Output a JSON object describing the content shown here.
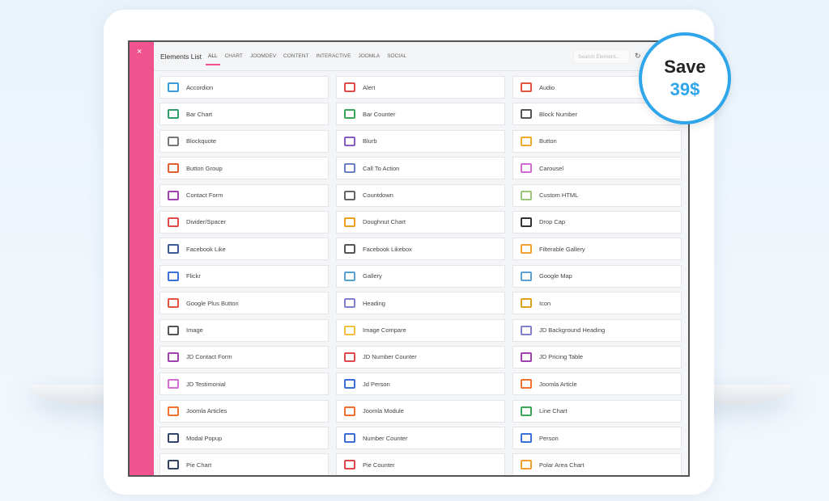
{
  "header": {
    "close": "×",
    "title": "Elements List",
    "tabs": [
      "ALL",
      "CHART",
      "JOOMDEV",
      "CONTENT",
      "INTERACTIVE",
      "JOOMLA",
      "SOCIAL"
    ],
    "search_placeholder": "Search Element...",
    "refresh": "↻"
  },
  "badge": {
    "line1": "Save",
    "line2": "39$"
  },
  "colors": {
    "accent": "#f0538d",
    "badge": "#2fa5ea"
  },
  "items": [
    {
      "label": "Accordion",
      "icon": "accordion-icon",
      "color": "#3b9ad9"
    },
    {
      "label": "Alert",
      "icon": "alert-icon",
      "color": "#e04a4a"
    },
    {
      "label": "Audio",
      "icon": "audio-icon",
      "color": "#e0533d"
    },
    {
      "label": "Bar Chart",
      "icon": "bar-chart-icon",
      "color": "#2e9e6a"
    },
    {
      "label": "Bar Counter",
      "icon": "bar-counter-icon",
      "color": "#3aa657"
    },
    {
      "label": "Block Number",
      "icon": "block-number-icon",
      "color": "#555555"
    },
    {
      "label": "Blockquote",
      "icon": "blockquote-icon",
      "color": "#777777"
    },
    {
      "label": "Blurb",
      "icon": "blurb-icon",
      "color": "#8a5cc7"
    },
    {
      "label": "Button",
      "icon": "button-icon",
      "color": "#f0a830"
    },
    {
      "label": "Button Group",
      "icon": "button-group-icon",
      "color": "#e0602d"
    },
    {
      "label": "Call To Action",
      "icon": "call-to-action-icon",
      "color": "#6a7fc7"
    },
    {
      "label": "Carousel",
      "icon": "carousel-icon",
      "color": "#d46ad4"
    },
    {
      "label": "Contact Form",
      "icon": "contact-form-icon",
      "color": "#a040b0"
    },
    {
      "label": "Countdown",
      "icon": "countdown-icon",
      "color": "#666666"
    },
    {
      "label": "Custom HTML",
      "icon": "custom-html-icon",
      "color": "#9cc77a"
    },
    {
      "label": "Divider/Spacer",
      "icon": "divider-icon",
      "color": "#e04a4a"
    },
    {
      "label": "Doughnut Chart",
      "icon": "doughnut-chart-icon",
      "color": "#f0a020"
    },
    {
      "label": "Drop Cap",
      "icon": "drop-cap-icon",
      "color": "#333333"
    },
    {
      "label": "Facebook Like",
      "icon": "facebook-like-icon",
      "color": "#3b5998"
    },
    {
      "label": "Facebook Likebox",
      "icon": "facebook-likebox-icon",
      "color": "#555555"
    },
    {
      "label": "Filterable Gallery",
      "icon": "filterable-gallery-icon",
      "color": "#f0a030"
    },
    {
      "label": "Flickr",
      "icon": "flickr-icon",
      "color": "#3b6fd9"
    },
    {
      "label": "Gallery",
      "icon": "gallery-icon",
      "color": "#5aa0d0"
    },
    {
      "label": "Google Map",
      "icon": "google-map-icon",
      "color": "#5aa0d0"
    },
    {
      "label": "Google Plus Button",
      "icon": "google-plus-icon",
      "color": "#e0533d"
    },
    {
      "label": "Heading",
      "icon": "heading-icon",
      "color": "#8080d0"
    },
    {
      "label": "Icon",
      "icon": "icon-icon",
      "color": "#e0a020"
    },
    {
      "label": "Image",
      "icon": "image-icon",
      "color": "#555555"
    },
    {
      "label": "Image Compare",
      "icon": "image-compare-icon",
      "color": "#f0c040"
    },
    {
      "label": "JD Background Heading",
      "icon": "background-heading-icon",
      "color": "#8080d0"
    },
    {
      "label": "JD Contact Form",
      "icon": "contact-form-icon",
      "color": "#a040b0"
    },
    {
      "label": "JD Number Counter",
      "icon": "number-counter-icon",
      "color": "#e04a4a"
    },
    {
      "label": "JD Pricing Table",
      "icon": "pricing-table-icon",
      "color": "#a040b0"
    },
    {
      "label": "JD Testimonial",
      "icon": "testimonial-icon",
      "color": "#d46ad4"
    },
    {
      "label": "Jd Person",
      "icon": "person-icon",
      "color": "#3b6fd9"
    },
    {
      "label": "Joomla Article",
      "icon": "joomla-icon",
      "color": "#f07030"
    },
    {
      "label": "Joomla Articles",
      "icon": "joomla-icon",
      "color": "#f07030"
    },
    {
      "label": "Joomla Module",
      "icon": "joomla-icon",
      "color": "#f07030"
    },
    {
      "label": "Line Chart",
      "icon": "line-chart-icon",
      "color": "#3aa657"
    },
    {
      "label": "Modal Popup",
      "icon": "modal-popup-icon",
      "color": "#334466"
    },
    {
      "label": "Number Counter",
      "icon": "number-counter-icon",
      "color": "#3b6fd9"
    },
    {
      "label": "Person",
      "icon": "person-icon",
      "color": "#3b6fd9"
    },
    {
      "label": "Pie Chart",
      "icon": "pie-chart-icon",
      "color": "#334466"
    },
    {
      "label": "Pie Counter",
      "icon": "pie-counter-icon",
      "color": "#e04a4a"
    },
    {
      "label": "Polar Area Chart",
      "icon": "polar-area-chart-icon",
      "color": "#f0a030"
    }
  ]
}
